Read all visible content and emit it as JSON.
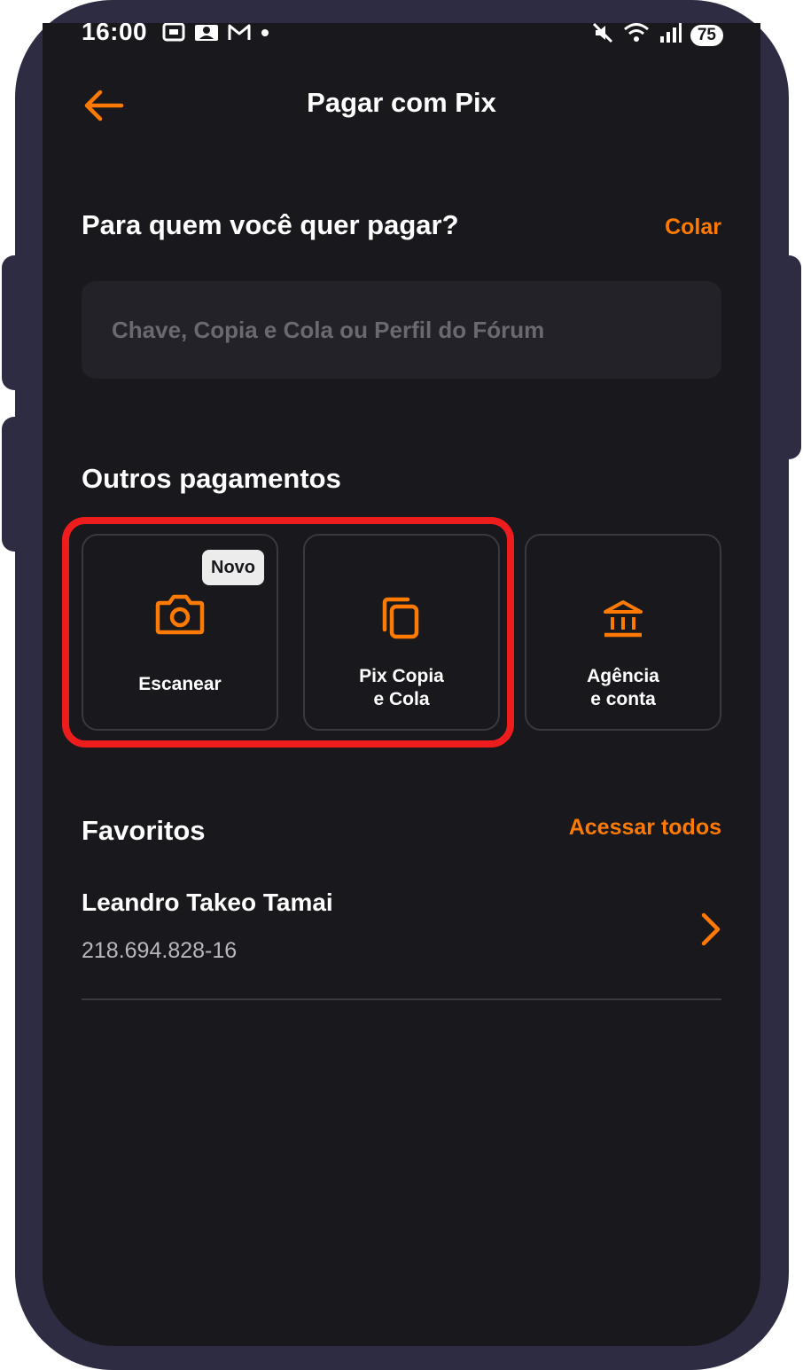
{
  "status_bar": {
    "time": "16:00",
    "battery": "75",
    "icons": [
      "screenshot-icon",
      "mail-icon",
      "gmail-icon",
      "notification-dot-icon",
      "mute-icon",
      "wifi-icon",
      "signal-icon"
    ]
  },
  "header": {
    "title": "Pagar com Pix",
    "back_icon": "arrow-left-icon"
  },
  "recipient": {
    "question": "Para quem você quer pagar?",
    "paste_label": "Colar",
    "input_placeholder": "Chave, Copia e Cola ou Perfil do Fórum",
    "input_value": ""
  },
  "other_payments": {
    "title": "Outros pagamentos",
    "options": [
      {
        "label": "Escanear",
        "icon": "camera-icon",
        "badge": "Novo"
      },
      {
        "label": "Pix Copia e Cola",
        "line1": "Pix Copia",
        "line2": "e Cola",
        "icon": "copy-icon"
      },
      {
        "label": "Agência e conta",
        "line1": "Agência",
        "line2": "e conta",
        "icon": "bank-icon"
      }
    ]
  },
  "favorites": {
    "title": "Favoritos",
    "access_all_label": "Acessar todos",
    "items": [
      {
        "name": "Leandro Takeo Tamai",
        "document": "218.694.828-16"
      }
    ]
  },
  "colors": {
    "accent": "#ff7a00",
    "background": "#19181d",
    "input_background": "#232228",
    "frame": "#2e2c42",
    "highlight": "#ee1d1d"
  }
}
